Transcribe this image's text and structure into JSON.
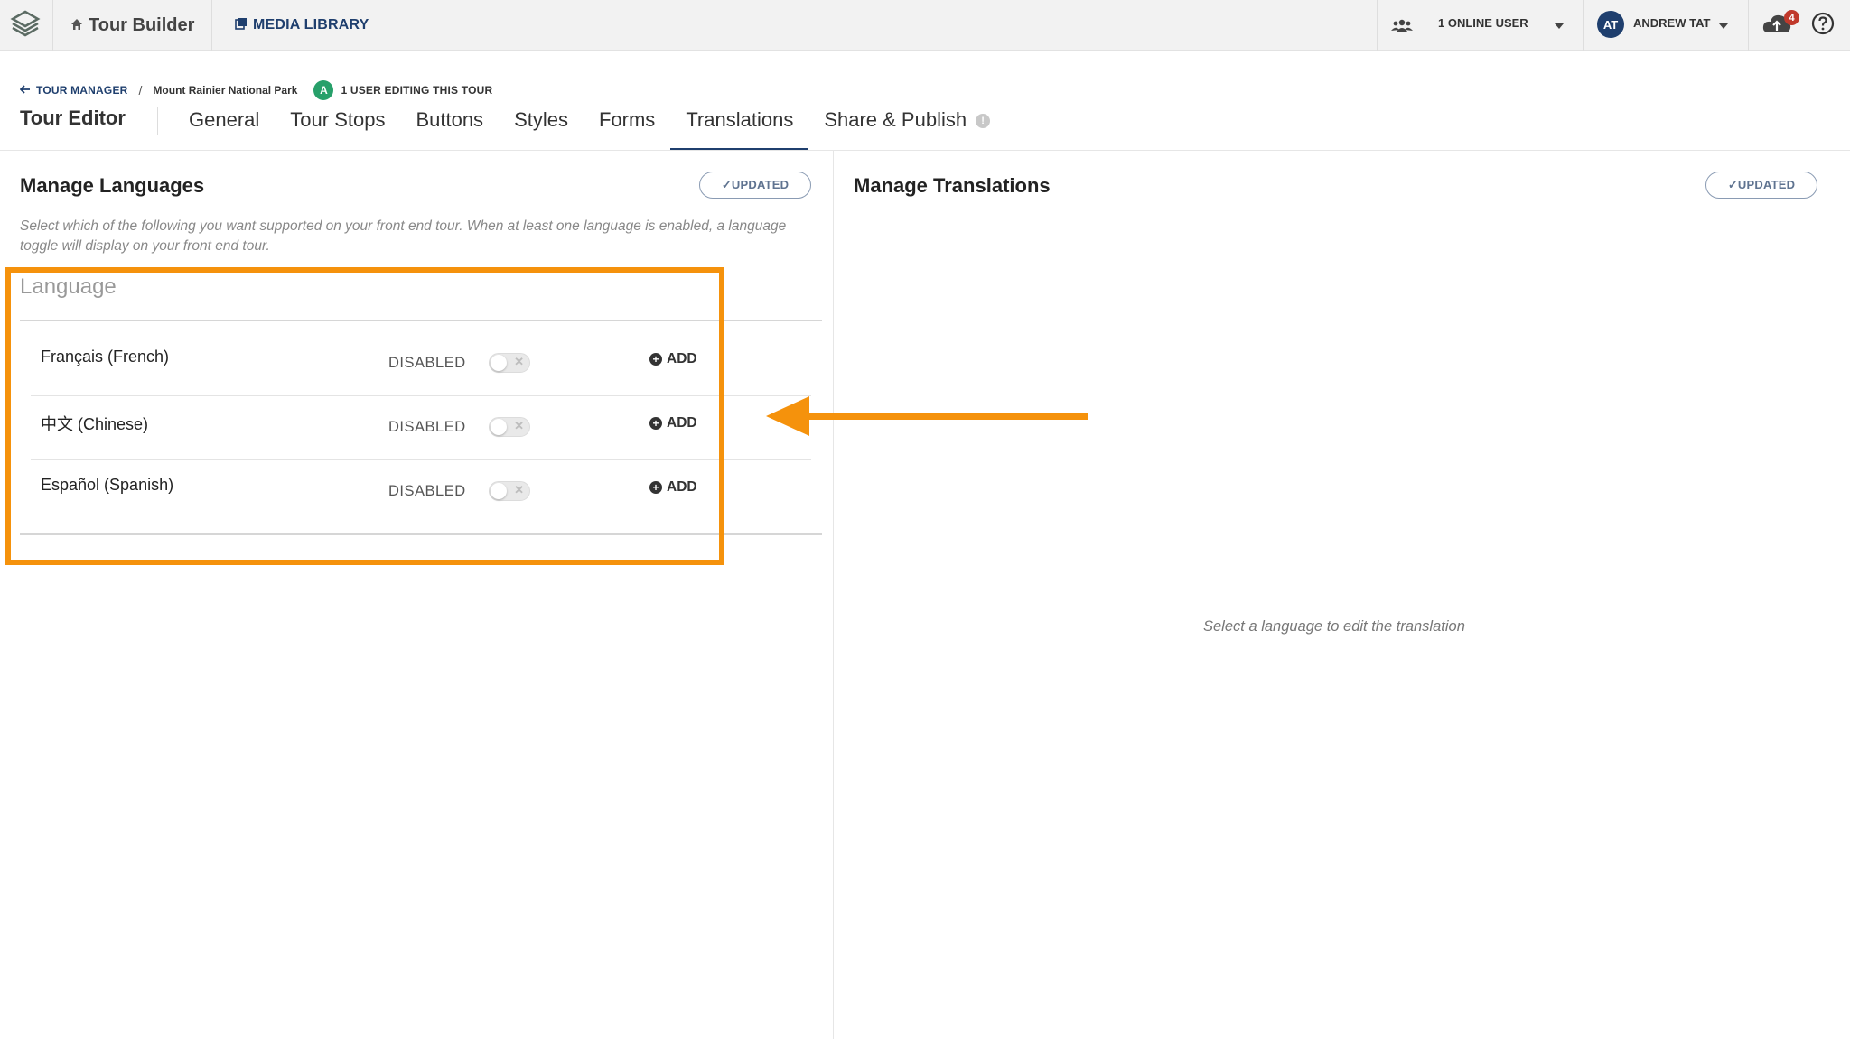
{
  "topbar": {
    "home_label": "Tour Builder",
    "media_label": "MEDIA LIBRARY",
    "online_users": "1 ONLINE USER",
    "user_initials": "AT",
    "user_name": "ANDREW TAT",
    "notification_count": "4"
  },
  "breadcrumb": {
    "back_label": "TOUR MANAGER",
    "separator": "/",
    "tour_name": "Mount Rainier National Park",
    "editor_initial": "A",
    "editing_label": "1 USER EDITING THIS TOUR"
  },
  "editor": {
    "title": "Tour Editor",
    "tabs": [
      {
        "label": "General"
      },
      {
        "label": "Tour Stops"
      },
      {
        "label": "Buttons"
      },
      {
        "label": "Styles"
      },
      {
        "label": "Forms"
      },
      {
        "label": "Translations",
        "active": true
      },
      {
        "label": "Share & Publish",
        "info": "!"
      }
    ]
  },
  "languages_panel": {
    "title": "Manage Languages",
    "status_label": "✓UPDATED",
    "description": "Select which of the following you want supported on your front end tour. When at least one language is enabled, a language toggle will display on your front end tour.",
    "column_header": "Language",
    "rows": [
      {
        "name": "Français (French)",
        "status": "DISABLED",
        "enabled": false,
        "add_label": "ADD"
      },
      {
        "name": "中文 (Chinese)",
        "status": "DISABLED",
        "enabled": false,
        "add_label": "ADD"
      },
      {
        "name": "Español (Spanish)",
        "status": "DISABLED",
        "enabled": false,
        "add_label": "ADD"
      }
    ]
  },
  "translations_panel": {
    "title": "Manage Translations",
    "status_label": "✓UPDATED",
    "empty_message": "Select a language to edit the translation"
  },
  "annotation": {
    "highlight_color": "#f5920c"
  }
}
